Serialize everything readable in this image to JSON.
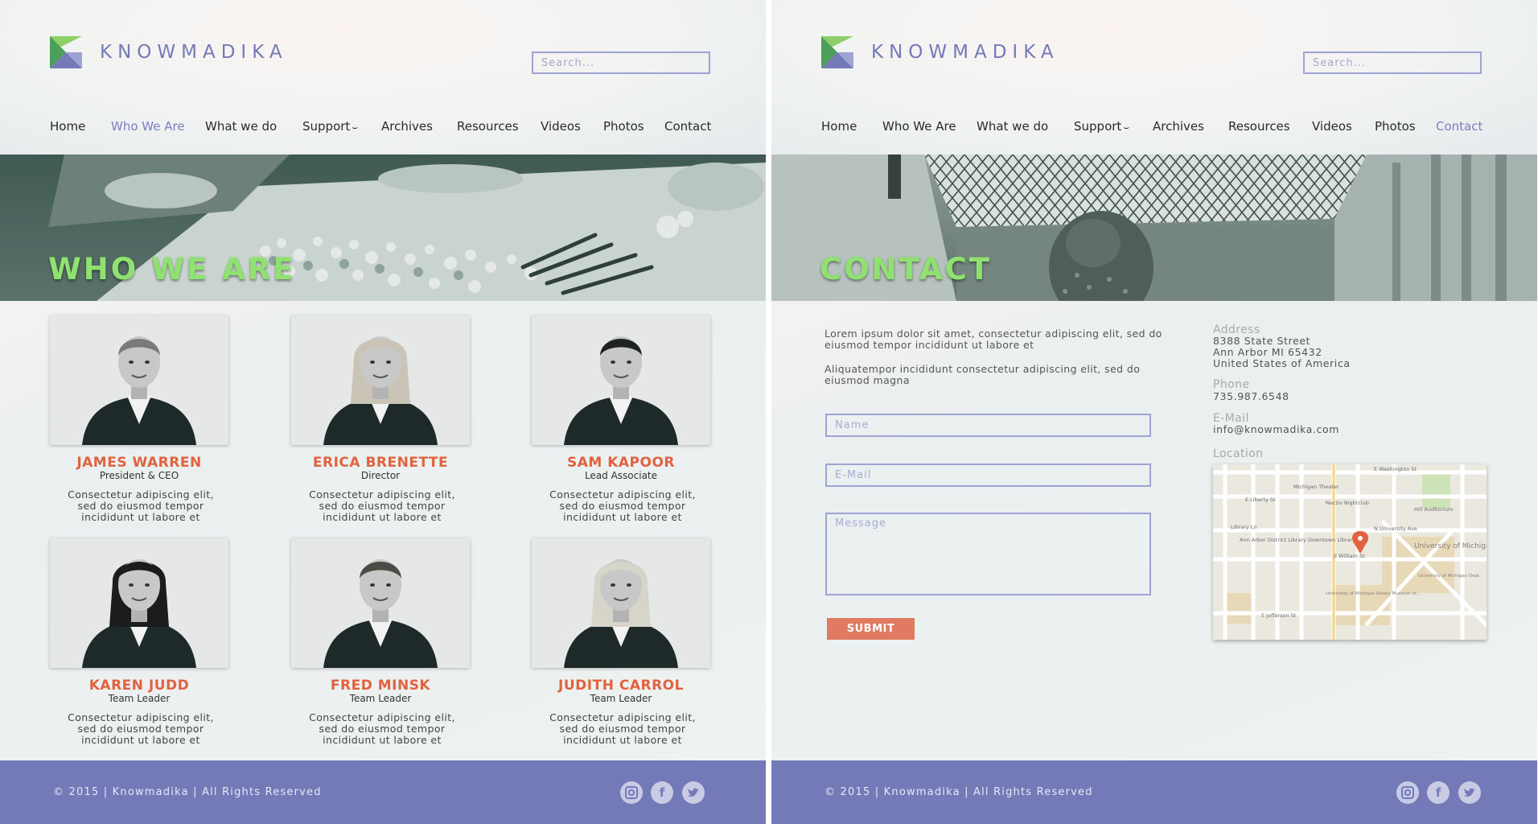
{
  "brand": {
    "name": "KNOWMADIKA",
    "accent": "#7479b8",
    "heading_green": "#8fe26f",
    "name_orange": "#e2623f"
  },
  "search": {
    "placeholder": "Search..."
  },
  "nav": {
    "items": [
      "Home",
      "Who We Are",
      "What we do",
      "Support",
      "Archives",
      "Resources",
      "Videos",
      "Photos",
      "Contact"
    ],
    "support_chevron": "⌣"
  },
  "who_page": {
    "title": "WHO WE ARE",
    "active_nav": "Who We Are",
    "members": [
      {
        "name": "JAMES WARREN",
        "role": "President & CEO",
        "bio": [
          "Consectetur adipiscing elit,",
          "sed do eiusmod tempor",
          "incididunt ut labore et"
        ]
      },
      {
        "name": "ERICA BRENETTE",
        "role": "Director",
        "bio": [
          "Consectetur adipiscing elit,",
          "sed do eiusmod tempor",
          "incididunt ut labore et"
        ]
      },
      {
        "name": "SAM KAPOOR",
        "role": "Lead Associate",
        "bio": [
          "Consectetur adipiscing elit,",
          "sed do eiusmod tempor",
          "incididunt ut labore et"
        ]
      },
      {
        "name": "KAREN JUDD",
        "role": "Team Leader",
        "bio": [
          "Consectetur adipiscing elit,",
          "sed do eiusmod tempor",
          "incididunt ut labore et"
        ]
      },
      {
        "name": "FRED MINSK",
        "role": "Team Leader",
        "bio": [
          "Consectetur adipiscing elit,",
          "sed do eiusmod tempor",
          "incididunt ut labore et"
        ]
      },
      {
        "name": "JUDITH CARROL",
        "role": "Team Leader",
        "bio": [
          "Consectetur adipiscing elit,",
          "sed do eiusmod tempor",
          "incididunt ut labore et"
        ]
      }
    ]
  },
  "contact_page": {
    "title": "CONTACT",
    "active_nav": "Contact",
    "intro": [
      "Lorem ipsum dolor sit amet, consectetur adipiscing elit, sed do eiusmod tempor incididunt ut labore et",
      "Aliquatempor incididunt consectetur adipiscing elit, sed do eiusmod magna"
    ],
    "form": {
      "name_placeholder": "Name",
      "email_placeholder": "E-Mail",
      "message_placeholder": "Message",
      "submit_label": "SUBMIT"
    },
    "info": {
      "address_label": "Address",
      "address_lines": [
        "8388 State Street",
        "Ann Arbor MI 65432",
        "United States of America"
      ],
      "phone_label": "Phone",
      "phone": "735.987.6548",
      "email_label": "E-Mail",
      "email": "info@knowmadika.com",
      "location_label": "Location"
    },
    "map_labels": {
      "washington": "E Washington St",
      "michigan_theater": "Michigan Theater",
      "liberty": "E Liberty St",
      "nectio": "Nectio Nightclub",
      "library_ln": "Library Ln",
      "aadl": "Ann Arbor District Library Downtown Library",
      "william": "E William St",
      "university_ave": "N University Ave",
      "umich": "University of Michigan",
      "kelsey": "University of Michigan Kelsey Museum of...",
      "jefferson": "E Jefferson St",
      "hill_auditorium": "Hill Auditorium",
      "umich_dept": "University of Michigan Dept"
    }
  },
  "footer": {
    "copyright": "© 2015  |  Knowmadika  |  All Rights Reserved",
    "social": [
      "instagram",
      "facebook",
      "twitter"
    ]
  }
}
